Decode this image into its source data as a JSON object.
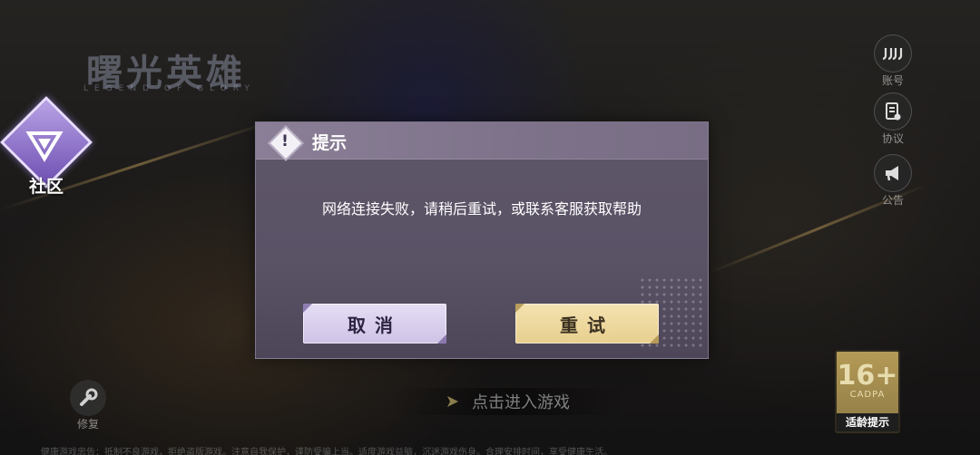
{
  "game": {
    "logo_text": "曙光英雄",
    "logo_subtext": "LEGEND OF GLORY"
  },
  "left_panel": {
    "community_label": "社区"
  },
  "right_panel": {
    "account_label": "账号",
    "agreement_label": "协议",
    "notice_label": "公告"
  },
  "bottom": {
    "repair_label": "修复",
    "enter_game_label": "点击进入游戏",
    "age_rating": "16+",
    "age_org": "CADPA",
    "age_tip_label": "适龄提示",
    "footer_text": "健康游戏忠告：抵制不良游戏，拒绝盗版游戏。注意自我保护，谨防受骗上当。适度游戏益脑，沉迷游戏伤身。合理安排时间，享受健康生活。"
  },
  "dialog": {
    "title": "提示",
    "icon": "warning-icon",
    "message": "网络连接失败，请稍后重试，或联系客服获取帮助",
    "cancel_label": "取消",
    "retry_label": "重试"
  },
  "colors": {
    "dialog_bg": "#5a5265",
    "dialog_header": "#7d7289",
    "cancel_button": "#ddd3ef",
    "retry_button": "#efd99e"
  }
}
